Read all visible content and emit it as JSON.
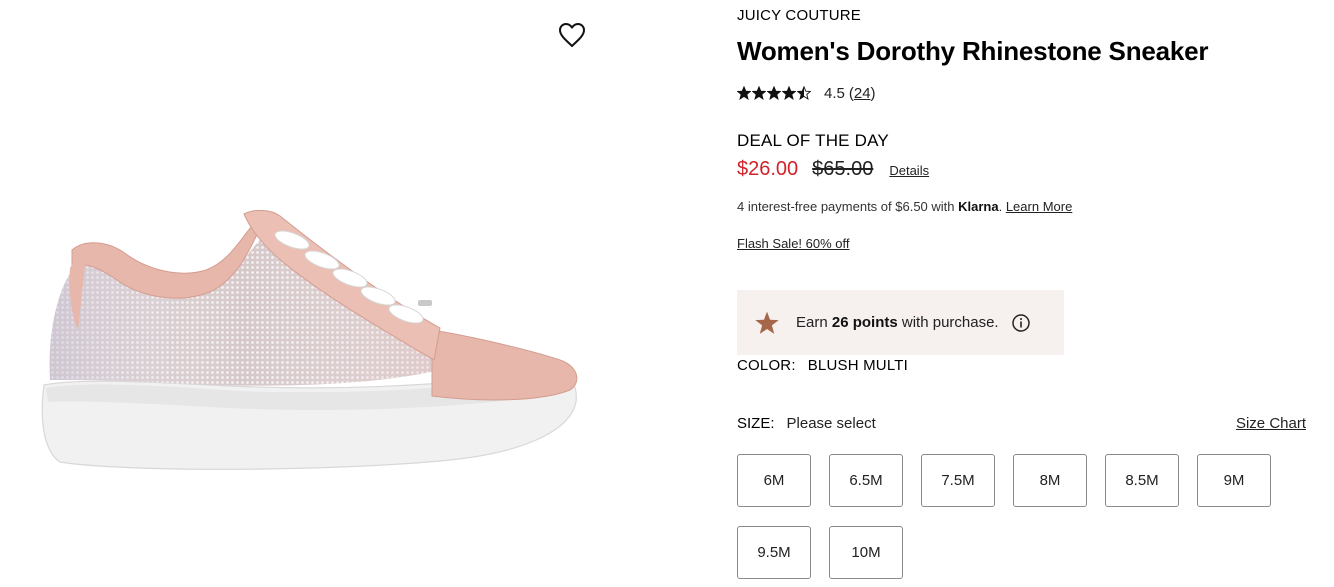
{
  "product": {
    "brand": "JUICY COUTURE",
    "title": "Women's Dorothy Rhinestone Sneaker",
    "rating": {
      "value": "4.5",
      "count": "24",
      "stars": 4.5
    },
    "deal_label": "DEAL OF THE DAY",
    "sale_price": "$26.00",
    "original_price": "$65.00",
    "details_link": "Details",
    "klarna": {
      "prefix": "4 interest-free payments of $6.50 with ",
      "brand": "Klarna",
      "suffix": ". ",
      "learn_more": "Learn More"
    },
    "flash_sale": "Flash Sale! 60% off",
    "points": {
      "prefix": "Earn ",
      "bold": "26 points",
      "suffix": " with purchase."
    },
    "color": {
      "label": "COLOR:",
      "value": "BLUSH MULTI"
    },
    "size": {
      "label": "SIZE:",
      "value": "Please select",
      "chart_link": "Size Chart",
      "options": [
        "6M",
        "6.5M",
        "7.5M",
        "8M",
        "8.5M",
        "9M",
        "9.5M",
        "10M"
      ]
    }
  },
  "icons": {
    "wishlist": "heart-outline-icon",
    "rating_star": "star-icon",
    "points_star": "bronze-star-icon",
    "info": "info-circle-icon"
  },
  "colors": {
    "sale_red": "#d12229",
    "points_bg": "#f6f0ef",
    "points_star": "#a5664a",
    "shoe_pink": "#e7b7ab",
    "sole": "#f1f1f1"
  }
}
